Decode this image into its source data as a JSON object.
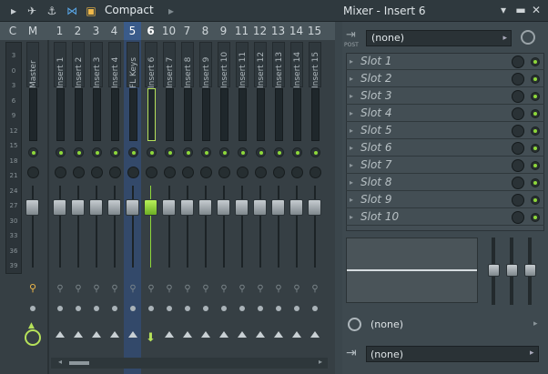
{
  "view": {
    "label": "Compact"
  },
  "window": {
    "title": "Mixer - Insert 6"
  },
  "header_cells": [
    "C",
    "M",
    "1",
    "2",
    "3",
    "4",
    "5",
    "6",
    "7",
    "8",
    "9",
    "10",
    "11",
    "12",
    "13",
    "14",
    "15"
  ],
  "strips": [
    {
      "id": "M",
      "label": "Master"
    },
    {
      "id": "1",
      "label": "Insert 1"
    },
    {
      "id": "2",
      "label": "Insert 2"
    },
    {
      "id": "3",
      "label": "Insert 3"
    },
    {
      "id": "4",
      "label": "Insert 4"
    },
    {
      "id": "5",
      "label": "FL Keys"
    },
    {
      "id": "6",
      "label": "Insert 6"
    },
    {
      "id": "7",
      "label": "Insert 7"
    },
    {
      "id": "8",
      "label": "Insert 8"
    },
    {
      "id": "9",
      "label": "Insert 9"
    },
    {
      "id": "10",
      "label": "Insert 10"
    },
    {
      "id": "11",
      "label": "Insert 11"
    },
    {
      "id": "12",
      "label": "Insert 12"
    },
    {
      "id": "13",
      "label": "Insert 13"
    },
    {
      "id": "14",
      "label": "Insert 14"
    },
    {
      "id": "15",
      "label": "Insert 15"
    }
  ],
  "meter_scale": [
    "3",
    "0",
    "3",
    "6",
    "9",
    "12",
    "15",
    "18",
    "21",
    "24",
    "27",
    "30",
    "33",
    "36",
    "39"
  ],
  "post_label": "POST",
  "input": {
    "value": "(none)"
  },
  "slots": [
    "Slot 1",
    "Slot 2",
    "Slot 3",
    "Slot 4",
    "Slot 5",
    "Slot 6",
    "Slot 7",
    "Slot 8",
    "Slot 9",
    "Slot 10"
  ],
  "send_time": {
    "value": "(none)"
  },
  "output": {
    "value": "(none)"
  },
  "colors": {
    "accent": "#8ed83a",
    "selected": "#3a5b8a"
  }
}
